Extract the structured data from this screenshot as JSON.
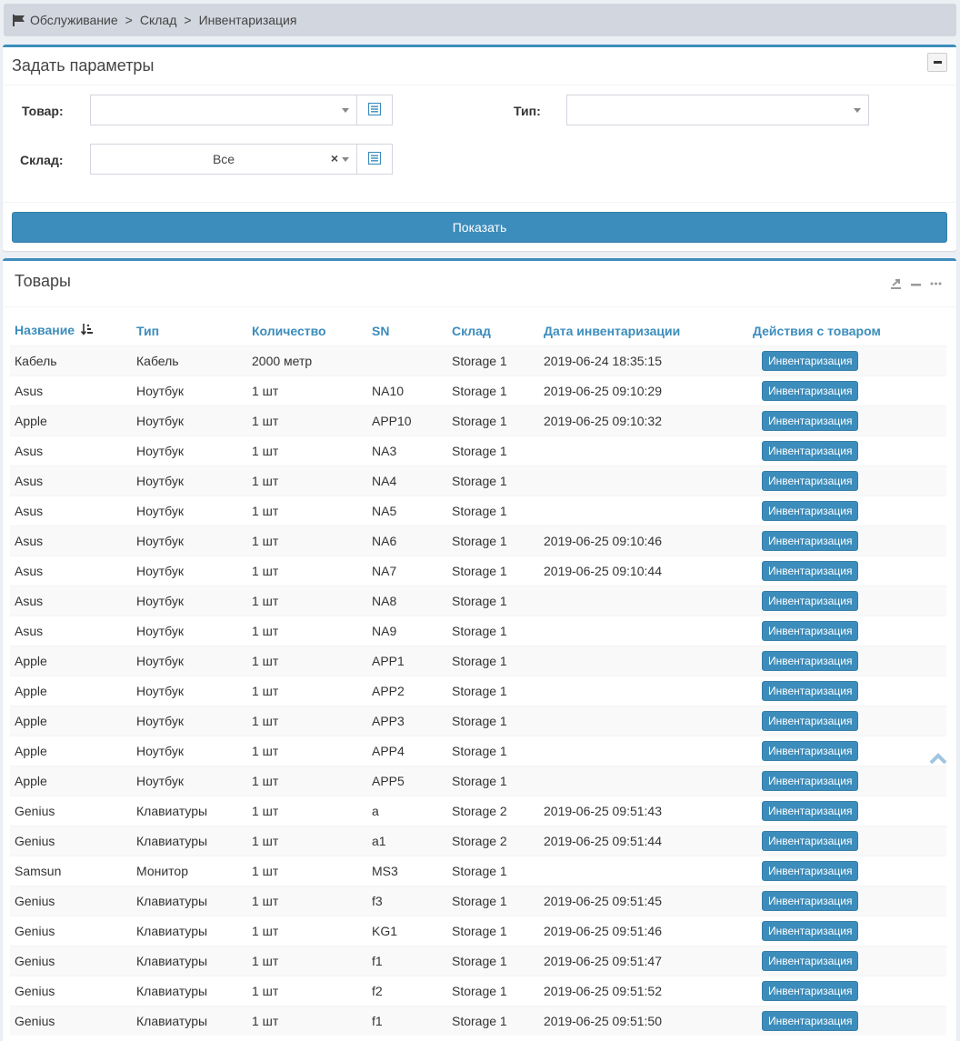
{
  "breadcrumb": {
    "items": [
      "Обслуживание",
      "Склад",
      "Инвентаризация"
    ],
    "separator": ">"
  },
  "params": {
    "title": "Задать параметры",
    "product_label": "Товар:",
    "product_value": "",
    "type_label": "Тип:",
    "type_value": "",
    "warehouse_label": "Склад:",
    "warehouse_value": "Все",
    "clear_symbol": "×",
    "show_button": "Показать"
  },
  "goods": {
    "title": "Товары",
    "columns": [
      "Название",
      "Тип",
      "Количество",
      "SN",
      "Склад",
      "Дата инвентаризации",
      "Действия с товаром"
    ],
    "action_label": "Инвентаризация",
    "rows": [
      [
        "Кабель",
        "Кабель",
        "2000 метр",
        "",
        "Storage 1",
        "2019-06-24 18:35:15"
      ],
      [
        "Asus",
        "Ноутбук",
        "1 шт",
        "NA10",
        "Storage 1",
        "2019-06-25 09:10:29"
      ],
      [
        "Apple",
        "Ноутбук",
        "1 шт",
        "APP10",
        "Storage 1",
        "2019-06-25 09:10:32"
      ],
      [
        "Asus",
        "Ноутбук",
        "1 шт",
        "NA3",
        "Storage 1",
        ""
      ],
      [
        "Asus",
        "Ноутбук",
        "1 шт",
        "NA4",
        "Storage 1",
        ""
      ],
      [
        "Asus",
        "Ноутбук",
        "1 шт",
        "NA5",
        "Storage 1",
        ""
      ],
      [
        "Asus",
        "Ноутбук",
        "1 шт",
        "NA6",
        "Storage 1",
        "2019-06-25 09:10:46"
      ],
      [
        "Asus",
        "Ноутбук",
        "1 шт",
        "NA7",
        "Storage 1",
        "2019-06-25 09:10:44"
      ],
      [
        "Asus",
        "Ноутбук",
        "1 шт",
        "NA8",
        "Storage 1",
        ""
      ],
      [
        "Asus",
        "Ноутбук",
        "1 шт",
        "NA9",
        "Storage 1",
        ""
      ],
      [
        "Apple",
        "Ноутбук",
        "1 шт",
        "APP1",
        "Storage 1",
        ""
      ],
      [
        "Apple",
        "Ноутбук",
        "1 шт",
        "APP2",
        "Storage 1",
        ""
      ],
      [
        "Apple",
        "Ноутбук",
        "1 шт",
        "APP3",
        "Storage 1",
        ""
      ],
      [
        "Apple",
        "Ноутбук",
        "1 шт",
        "APP4",
        "Storage 1",
        ""
      ],
      [
        "Apple",
        "Ноутбук",
        "1 шт",
        "APP5",
        "Storage 1",
        ""
      ],
      [
        "Genius",
        "Клавиатуры",
        "1 шт",
        "a",
        "Storage 2",
        "2019-06-25 09:51:43"
      ],
      [
        "Genius",
        "Клавиатуры",
        "1 шт",
        "a1",
        "Storage 2",
        "2019-06-25 09:51:44"
      ],
      [
        "Samsun",
        "Монитор",
        "1 шт",
        "MS3",
        "Storage 1",
        ""
      ],
      [
        "Genius",
        "Клавиатуры",
        "1 шт",
        "f3",
        "Storage 1",
        "2019-06-25 09:51:45"
      ],
      [
        "Genius",
        "Клавиатуры",
        "1 шт",
        "KG1",
        "Storage 1",
        "2019-06-25 09:51:46"
      ],
      [
        "Genius",
        "Клавиатуры",
        "1 шт",
        "f1",
        "Storage 1",
        "2019-06-25 09:51:47"
      ],
      [
        "Genius",
        "Клавиатуры",
        "1 шт",
        "f2",
        "Storage 1",
        "2019-06-25 09:51:52"
      ],
      [
        "Genius",
        "Клавиатуры",
        "1 шт",
        "f1",
        "Storage 1",
        "2019-06-25 09:51:50"
      ]
    ]
  },
  "icons": {
    "breadcrumb": "flag-icon",
    "sort": "sort-amount-down-icon",
    "export": "export-icon",
    "minimize": "minus-icon",
    "more": "ellipsis-icon",
    "scroll_top": "chevron-up-icon",
    "list": "list-icon"
  },
  "colors": {
    "primary": "#3c8dbc",
    "breadcrumb_bg": "#d2d6de"
  }
}
